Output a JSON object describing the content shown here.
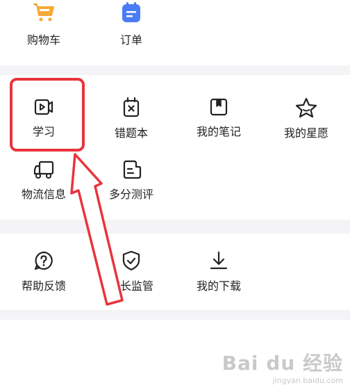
{
  "top_row": [
    {
      "label": "购物车",
      "icon": "shopping-cart-icon",
      "color": "#f7a935"
    },
    {
      "label": "订单",
      "icon": "order-list-icon",
      "color": "#4a7cf6"
    }
  ],
  "tools": [
    {
      "label": "学习",
      "icon": "video-study-icon"
    },
    {
      "label": "错题本",
      "icon": "wrong-question-book-icon"
    },
    {
      "label": "我的笔记",
      "icon": "note-icon"
    },
    {
      "label": "我的星愿",
      "icon": "star-wish-icon"
    },
    {
      "label": "物流信息",
      "icon": "delivery-truck-icon"
    },
    {
      "label": "多分测评",
      "icon": "assessment-doc-icon"
    }
  ],
  "services": [
    {
      "label": "帮助反馈",
      "icon": "help-question-icon"
    },
    {
      "label": "家长监管",
      "icon": "shield-check-icon"
    },
    {
      "label": "我的下载",
      "icon": "download-icon"
    }
  ],
  "watermark": {
    "text": "Bai du 经验",
    "url": "jingyan.baidu.com"
  },
  "colors": {
    "annotation": "#e8343d",
    "icon_stroke": "#222222",
    "section_gap": "#f4f4f6"
  }
}
